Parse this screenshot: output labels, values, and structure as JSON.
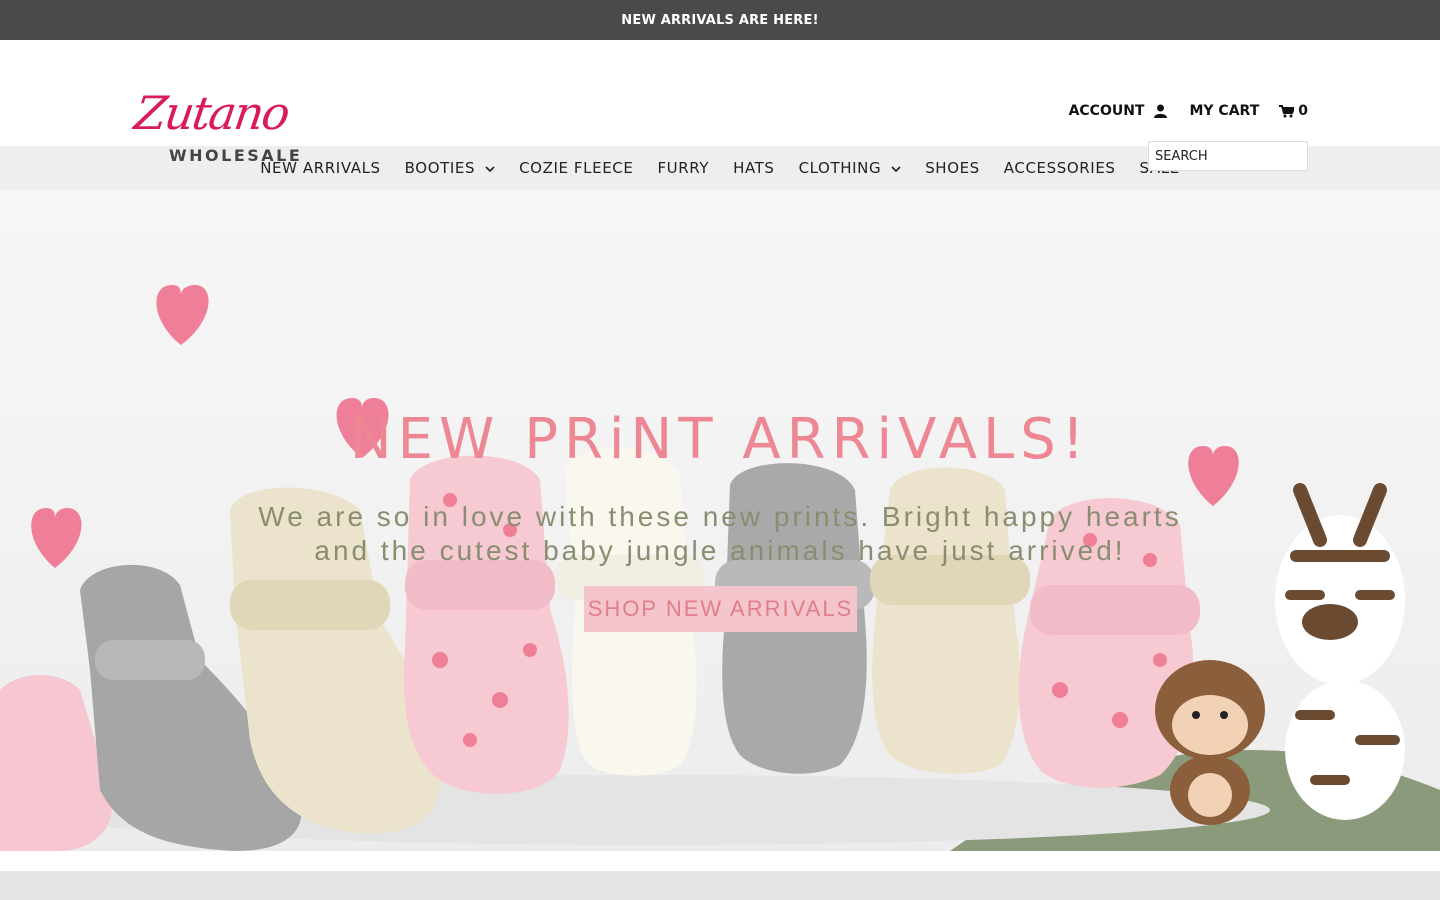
{
  "announcement": "NEW ARRIVALS ARE HERE!",
  "brand": {
    "script": "Zutano",
    "sub": "WHOLESALE",
    "color": "#d81b5e"
  },
  "header": {
    "account_label": "ACCOUNT",
    "account_icon": "user-icon",
    "cart_label": "MY CART",
    "cart_icon": "cart-icon",
    "cart_count": "0",
    "search_placeholder": "SEARCH"
  },
  "nav": [
    {
      "label": "NEW ARRIVALS",
      "dropdown": false
    },
    {
      "label": "BOOTIES",
      "dropdown": true
    },
    {
      "label": "COZIE FLEECE",
      "dropdown": false
    },
    {
      "label": "FURRY",
      "dropdown": false
    },
    {
      "label": "HATS",
      "dropdown": false
    },
    {
      "label": "CLOTHING",
      "dropdown": true
    },
    {
      "label": "SHOES",
      "dropdown": false
    },
    {
      "label": "ACCESSORIES",
      "dropdown": false
    },
    {
      "label": "SALE",
      "dropdown": false
    }
  ],
  "hero": {
    "title": "NEW PRiNT ARRiVALS!",
    "subtitle_line1": "We are so in love with these new prints. Bright happy hearts",
    "subtitle_line2": "and the cutest baby jungle animals have just arrived!",
    "cta_label": "SHOP NEW ARRIVALS",
    "colors": {
      "accent": "#ec8793",
      "subtitle": "#8a8e70",
      "cta_bg": "#f4c5cc"
    }
  }
}
